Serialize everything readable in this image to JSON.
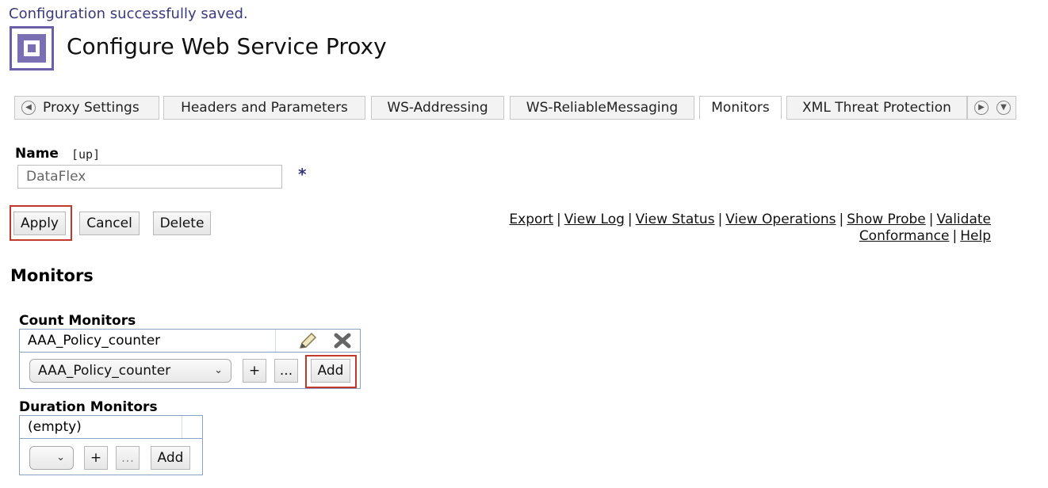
{
  "status_message": "Configuration successfully saved.",
  "page_title": "Configure Web Service Proxy",
  "tabs": [
    {
      "label": "Proxy Settings"
    },
    {
      "label": "Headers and Parameters"
    },
    {
      "label": "WS-Addressing"
    },
    {
      "label": "WS-ReliableMessaging"
    },
    {
      "label": "Monitors"
    },
    {
      "label": "XML Threat Protection"
    }
  ],
  "active_tab": "Monitors",
  "name_field": {
    "label": "Name",
    "status": "[up]",
    "value": "DataFlex",
    "required_mark": "*"
  },
  "buttons": {
    "apply": "Apply",
    "cancel": "Cancel",
    "delete": "Delete"
  },
  "links": {
    "export": "Export",
    "view_log": "View Log",
    "view_status": "View Status",
    "view_operations": "View Operations",
    "show_probe": "Show Probe",
    "validate": "Validate",
    "conformance": "Conformance",
    "help": "Help"
  },
  "monitors": {
    "section_title": "Monitors",
    "count": {
      "label": "Count Monitors",
      "entries": [
        "AAA_Policy_counter"
      ],
      "selected": "AAA_Policy_counter",
      "plus": "+",
      "ellipsis": "...",
      "add": "Add"
    },
    "duration": {
      "label": "Duration Monitors",
      "entries": [
        "(empty)"
      ],
      "selected": "",
      "plus": "+",
      "ellipsis": "...",
      "add": "Add"
    }
  },
  "colors": {
    "highlight": "#c0392b",
    "table_border": "#8aa3c2",
    "logo": "#6b5fa8"
  },
  "icons": [
    "logo-icon",
    "scroll-left-icon",
    "scroll-right-icon",
    "tab-menu-icon",
    "edit-pencil-icon",
    "delete-x-icon",
    "select-chevron-icon"
  ]
}
